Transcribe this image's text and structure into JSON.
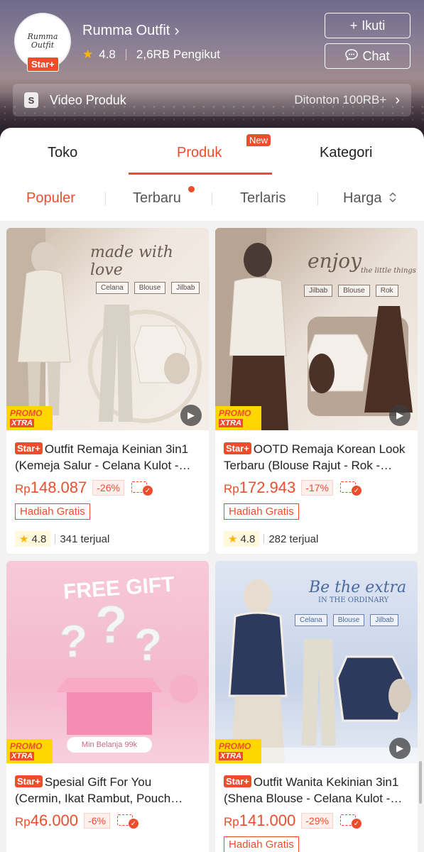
{
  "shop": {
    "name": "Rumma Outfit",
    "logo_text": "Rumma Outfit",
    "badge": "Star+",
    "rating": "4.8",
    "followers": "2,6RB Pengikut",
    "follow_label": "Ikuti",
    "chat_label": "Chat"
  },
  "video": {
    "label": "Video Produk",
    "views": "Ditonton 100RB+"
  },
  "tabs": [
    {
      "label": "Toko"
    },
    {
      "label": "Produk",
      "badge": "New"
    },
    {
      "label": "Kategori"
    }
  ],
  "sort": [
    "Populer",
    "Terbaru",
    "Terlaris",
    "Harga"
  ],
  "promo": {
    "line1": "PROMO",
    "line2": "XTRA"
  },
  "products": [
    {
      "badge": "Star+",
      "title": "Outfit Remaja Keinian 3in1 (Kemeja Salur - Celana Kulot - Jilbab)",
      "currency": "Rp",
      "price": "148.087",
      "discount": "-26%",
      "gift": "Hadiah Gratis",
      "rating": "4.8",
      "sold": "341 terjual",
      "image": {
        "headline": "made with love",
        "pills": [
          "Celana",
          "Blouse",
          "Jilbab"
        ]
      }
    },
    {
      "badge": "Star+",
      "title": "OOTD Remaja Korean Look Terbaru (Blouse Rajut - Rok - Jilbab)",
      "currency": "Rp",
      "price": "172.943",
      "discount": "-17%",
      "gift": "Hadiah Gratis",
      "rating": "4.8",
      "sold": "282 terjual",
      "image": {
        "headline": "enjoy",
        "subhead": "the little things",
        "pills": [
          "Jilbab",
          "Blouse",
          "Rok"
        ]
      }
    },
    {
      "badge": "Star+",
      "title": "Spesial Gift For You (Cermin, Ikat Rambut, Pouch Bunga)",
      "currency": "Rp",
      "price": "46.000",
      "discount": "-6%",
      "image": {
        "headline": "FREE GIFT",
        "note": "Min Belanja 99k"
      }
    },
    {
      "badge": "Star+",
      "title": "Outfit Wanita Kekinian 3in1 (Shena Blouse - Celana Kulot - Jilbab)",
      "currency": "Rp",
      "price": "141.000",
      "discount": "-29%",
      "gift": "Hadiah Gratis",
      "image": {
        "headline": "Be the extra",
        "subhead": "IN THE ORDINARY",
        "pills": [
          "Celana",
          "Blouse",
          "Jilbab"
        ]
      }
    }
  ],
  "colors": {
    "accent": "#ee4d2d",
    "rating_star": "#ffb400"
  },
  "icons": [
    "chevron-right-icon",
    "star-icon",
    "plus-icon",
    "chat-icon",
    "video-icon",
    "sort-updown-icon",
    "play-icon",
    "voucher-check-icon"
  ]
}
